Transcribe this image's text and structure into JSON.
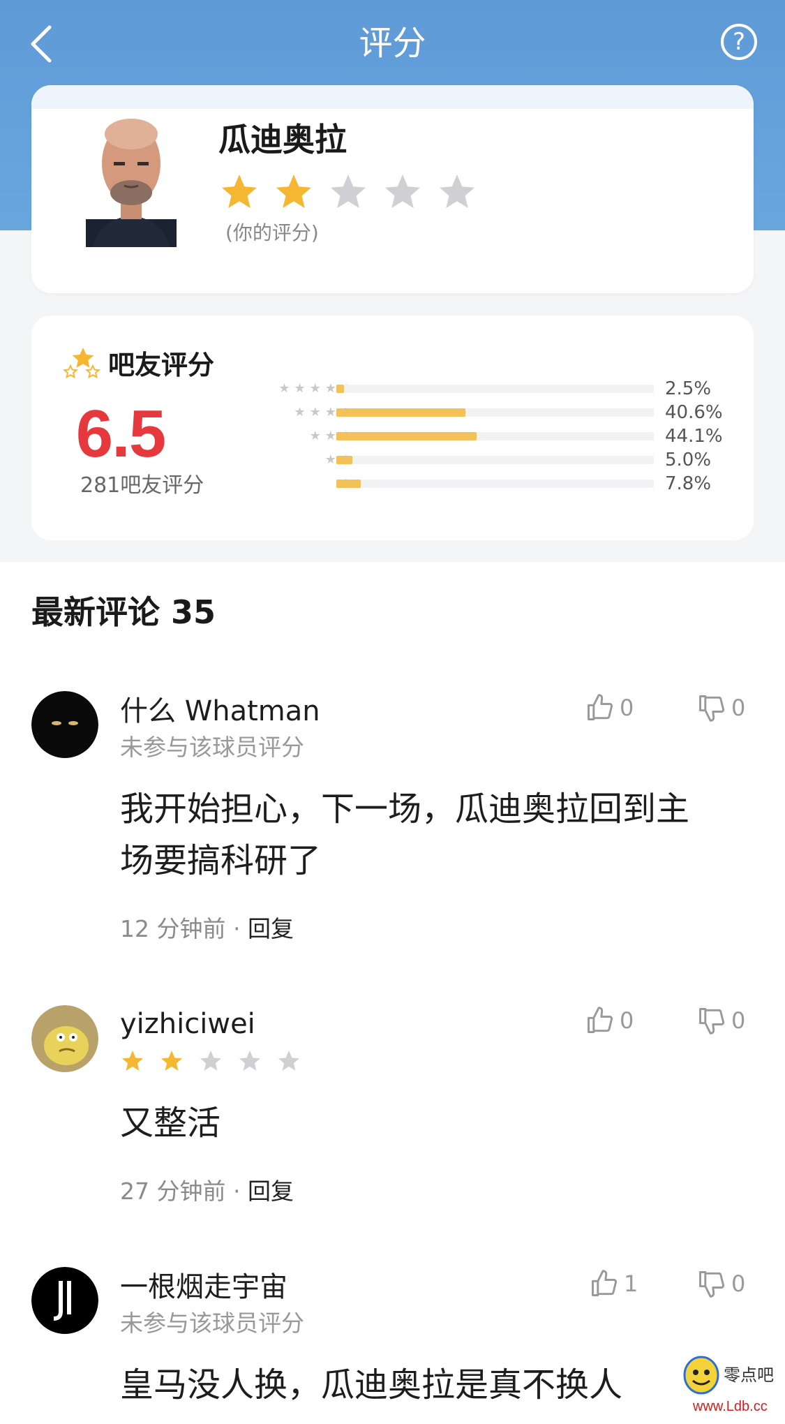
{
  "nav": {
    "title": "评分",
    "help": "?"
  },
  "profile": {
    "name": "瓜迪奥拉",
    "user_rating_stars": 2,
    "max_stars": 5,
    "your_rating_label": "(你的评分)"
  },
  "rating": {
    "title": "吧友评分",
    "score": "6.5",
    "count_label": "281吧友评分",
    "distribution": [
      {
        "stars": 5,
        "percent": 2.5,
        "label": "2.5%"
      },
      {
        "stars": 4,
        "percent": 40.6,
        "label": "40.6%"
      },
      {
        "stars": 3,
        "percent": 44.1,
        "label": "44.1%"
      },
      {
        "stars": 2,
        "percent": 5.0,
        "label": "5.0%"
      },
      {
        "stars": 1,
        "percent": 7.8,
        "label": "7.8%"
      }
    ]
  },
  "comments_section": {
    "title": "最新评论 35"
  },
  "comments": [
    {
      "user": "什么 Whatman",
      "subtitle": "未参与该球员评分",
      "text_line1": "我开始担心，下一场，瓜迪奥拉回到主",
      "text_line2": "场要搞科研了",
      "time": "12 分钟前",
      "reply": "回复",
      "likes": "0",
      "dislikes": "0"
    },
    {
      "user": "yizhiciwei",
      "stars": 2,
      "text_line1": "又整活",
      "time": "27 分钟前",
      "reply": "回复",
      "likes": "0",
      "dislikes": "0"
    },
    {
      "user": "一根烟走宇宙",
      "subtitle": "未参与该球员评分",
      "text_line1": "皇马没人换，瓜迪奥拉是真不换人",
      "likes": "1",
      "dislikes": "0"
    }
  ],
  "watermark": {
    "text1": "零点吧",
    "text2": "www.Ldb.cc"
  },
  "colors": {
    "header": "#5e9ad6",
    "score": "#e5393d",
    "star_active": "#f5b731",
    "star_inactive": "#cfcfd4",
    "bar": "#f2c259"
  }
}
